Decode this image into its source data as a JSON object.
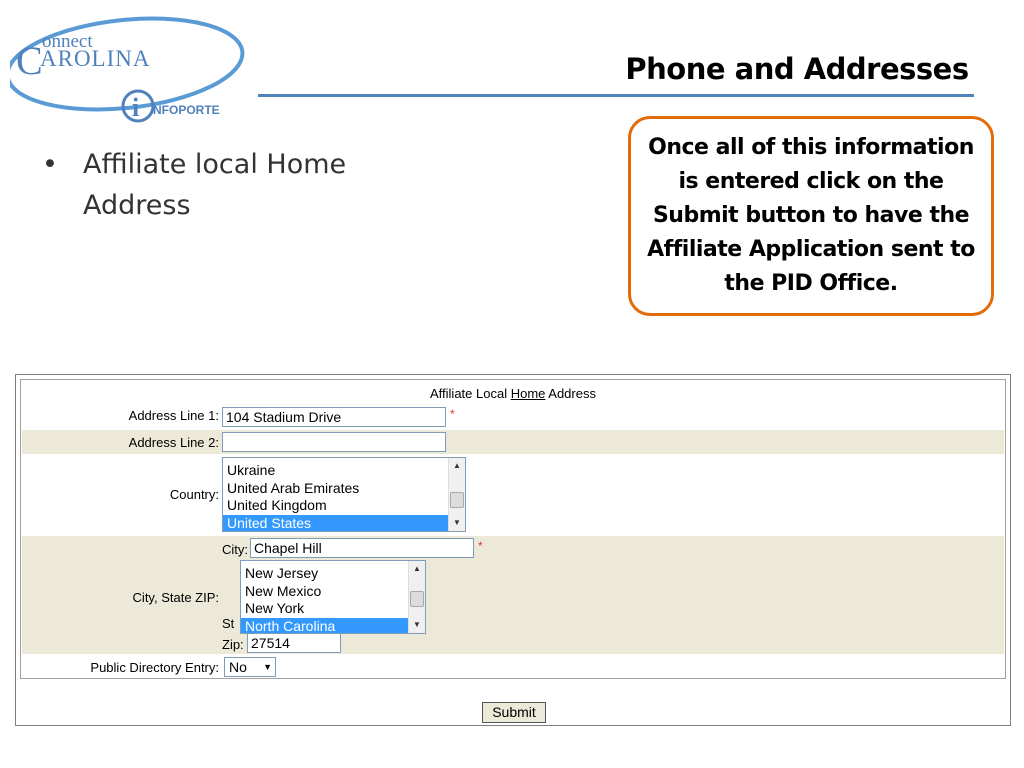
{
  "logo": {
    "connect": "onnect",
    "carolina": "AROLINA",
    "infoporte": "NFOPORTE"
  },
  "slide": {
    "title": "Phone and Addresses",
    "bullet": "Affiliate local Home Address",
    "callout": "Once all of this information is entered click on the Submit button to have the Affiliate Application sent to the PID Office."
  },
  "form": {
    "title_prefix": "Affiliate Local ",
    "title_underlined": "Home",
    "title_suffix": " Address",
    "address_line1_label": "Address Line 1:",
    "address_line1_value": "104 Stadium Drive",
    "address_line2_label": "Address Line 2:",
    "address_line2_value": "",
    "required_mark": "*",
    "country_label": "Country:",
    "country_options": [
      "Ukraine",
      "United Arab Emirates",
      "United Kingdom",
      "United States"
    ],
    "country_selected": "United States",
    "city_state_zip_label": "City, State ZIP:",
    "city_label": "City:",
    "city_value": "Chapel Hill",
    "state_label": "St",
    "state_options": [
      "New Jersey",
      "New Mexico",
      "New York",
      "North Carolina"
    ],
    "state_selected": "North Carolina",
    "zip_label": "Zip:",
    "zip_value": "27514",
    "public_directory_label": "Public Directory Entry:",
    "public_directory_value": "No",
    "submit_label": "Submit"
  },
  "colors": {
    "accent_blue": "#4f81bd",
    "callout_border": "#e36c0a",
    "selected_option": "#3399ff",
    "row_shade": "#ece9d8",
    "required": "#e03030"
  }
}
